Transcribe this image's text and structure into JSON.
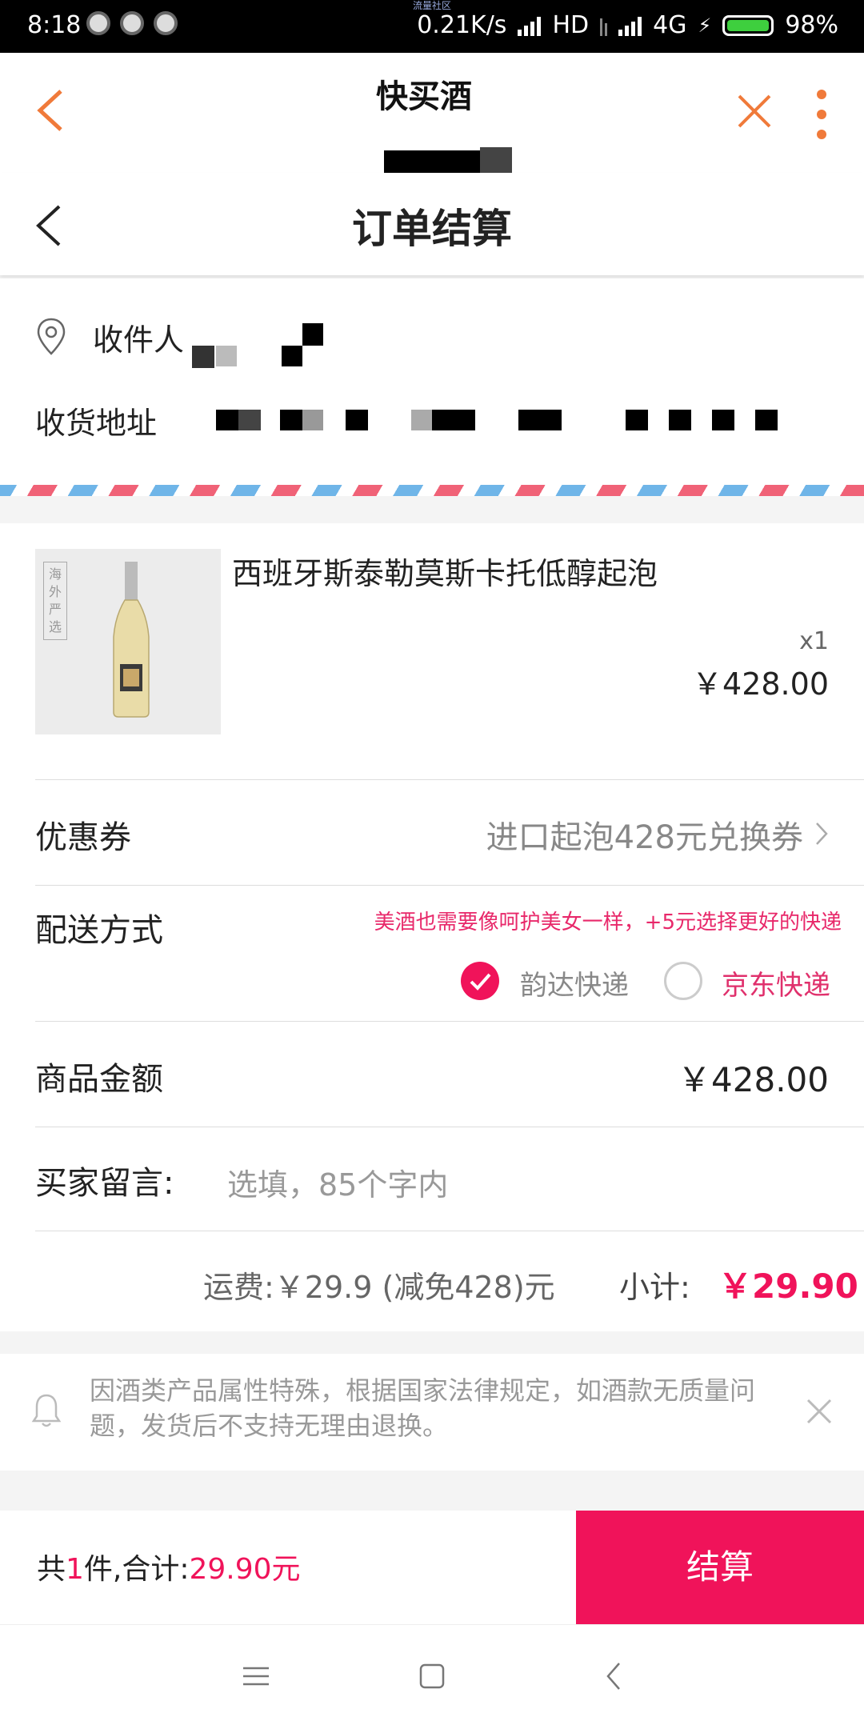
{
  "status_bar": {
    "time": "8:18",
    "network_speed": "0.21K/s",
    "hd": "HD",
    "network": "4G",
    "battery": "98%",
    "top_tiny": "流量社区"
  },
  "browser_bar": {
    "title": "快买酒"
  },
  "page_header": {
    "title": "订单结算"
  },
  "address": {
    "recipient_label": "收件人",
    "address_label": "收货地址"
  },
  "product": {
    "name": "西班牙斯泰勒莫斯卡托低醇起泡",
    "thumb_text": "海外严选",
    "quantity": "x1",
    "price": "￥428.00"
  },
  "coupon": {
    "label": "优惠券",
    "value": "进口起泡428元兑换券"
  },
  "delivery": {
    "label": "配送方式",
    "note": "美酒也需要像呵护美女一样，+5元选择更好的快递",
    "options": [
      {
        "label": "韵达快递",
        "selected": true
      },
      {
        "label": "京东快递",
        "selected": false
      }
    ]
  },
  "amount": {
    "label": "商品金额",
    "value": "￥428.00"
  },
  "message": {
    "label": "买家留言:",
    "placeholder": "选填，85个字内"
  },
  "subtotal": {
    "shipping": "运费:￥29.9 (减免428)元",
    "label": "小计:",
    "value": "￥29.90"
  },
  "notice": {
    "text": "因酒类产品属性特殊，根据国家法律规定，如酒款无质量问题，发货后不支持无理由退换。"
  },
  "footer": {
    "prefix": "共",
    "count": "1",
    "mid": "件,合计:",
    "total": "29.90元",
    "pay_label": "结算"
  },
  "colors": {
    "accent": "#f0135a",
    "orange": "#f07a3a"
  }
}
